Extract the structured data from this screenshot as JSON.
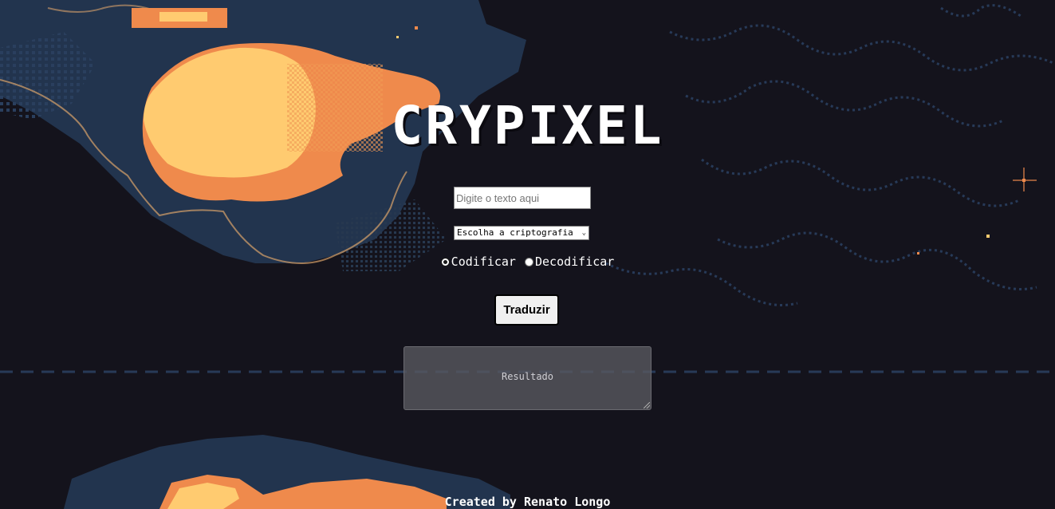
{
  "app": {
    "title": "CRYPIXEL"
  },
  "form": {
    "text_input": {
      "placeholder": "Digite o texto aqui",
      "value": ""
    },
    "cipher_select": {
      "selected": "Escolha a criptografia",
      "chevron_icon": "chevron-down-icon"
    },
    "mode": {
      "encode_label": "Codificar",
      "decode_label": "Decodificar",
      "selected": "Codificar"
    },
    "submit_label": "Traduzir",
    "result_placeholder": "Resultado"
  },
  "footer": {
    "text": "Created by Renato Longo"
  },
  "colors": {
    "background": "#14131c",
    "land_dark": "#22344e",
    "glow_orange": "#ef8a4c",
    "glow_yellow": "#ffcb70",
    "text": "#ffffff"
  }
}
